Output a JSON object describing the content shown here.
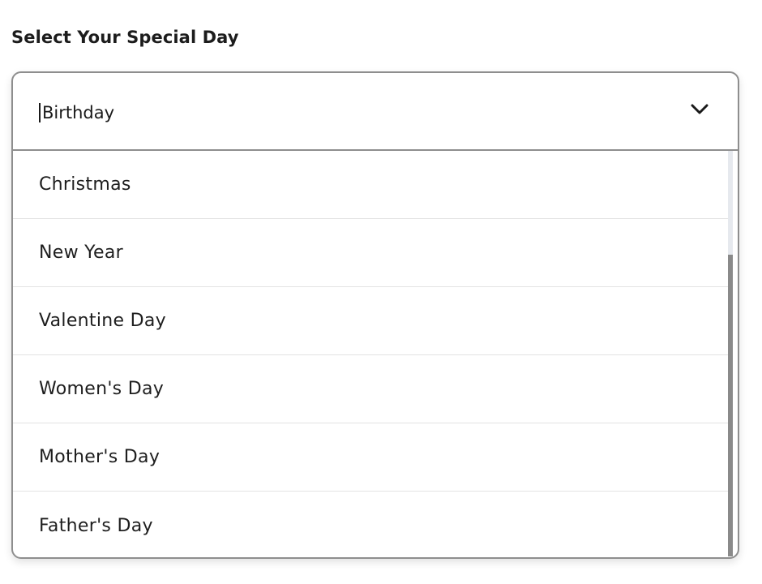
{
  "label": "Select Your Special Day",
  "combobox": {
    "value": "Birthday",
    "expanded": true,
    "toggle_icon": "chevron-down-icon"
  },
  "options": [
    {
      "label": "Christmas"
    },
    {
      "label": "New Year"
    },
    {
      "label": "Valentine Day"
    },
    {
      "label": "Women's Day"
    },
    {
      "label": "Mother's Day"
    },
    {
      "label": "Father's Day"
    }
  ],
  "colors": {
    "border": "#8e8e8e",
    "divider": "#e3e3e3",
    "text": "#1a1a1a",
    "scroll_track": "#e6e9ee",
    "scroll_thumb": "#8a8a8a"
  }
}
